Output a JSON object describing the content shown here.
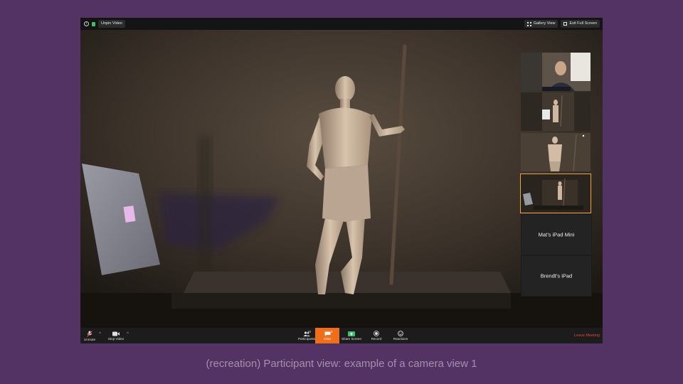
{
  "topbar": {
    "unpin_label": "Unpin Video",
    "gallery_label": "Gallery View",
    "exit_fullscreen_label": "Exit Full Screen"
  },
  "thumbnails": [
    {
      "kind": "camera",
      "scene": "person-webcam"
    },
    {
      "kind": "camera",
      "scene": "statue-wide"
    },
    {
      "kind": "camera",
      "scene": "statue-close"
    },
    {
      "kind": "camera",
      "scene": "statue-far",
      "active": true
    },
    {
      "kind": "name",
      "label": "Mat’s iPad Mini"
    },
    {
      "kind": "name",
      "label": "Brendt’s iPad"
    }
  ],
  "bottombar": {
    "unmute_label": "Unmute",
    "stop_video_label": "Stop Video",
    "participants_label": "Participants",
    "participants_count": "10",
    "chat_label": "Chat",
    "chat_count": "2",
    "share_label": "Share Screen",
    "record_label": "Record",
    "reactions_label": "Reactions",
    "leave_label": "Leave Meeting"
  },
  "caption": "(recreation) Participant view: example of a camera view 1",
  "colors": {
    "background": "#533364",
    "chat_accent": "#f06d19",
    "share_accent": "#3cc06a",
    "leave": "#e2473c",
    "active_tile": "#f0a23c"
  }
}
